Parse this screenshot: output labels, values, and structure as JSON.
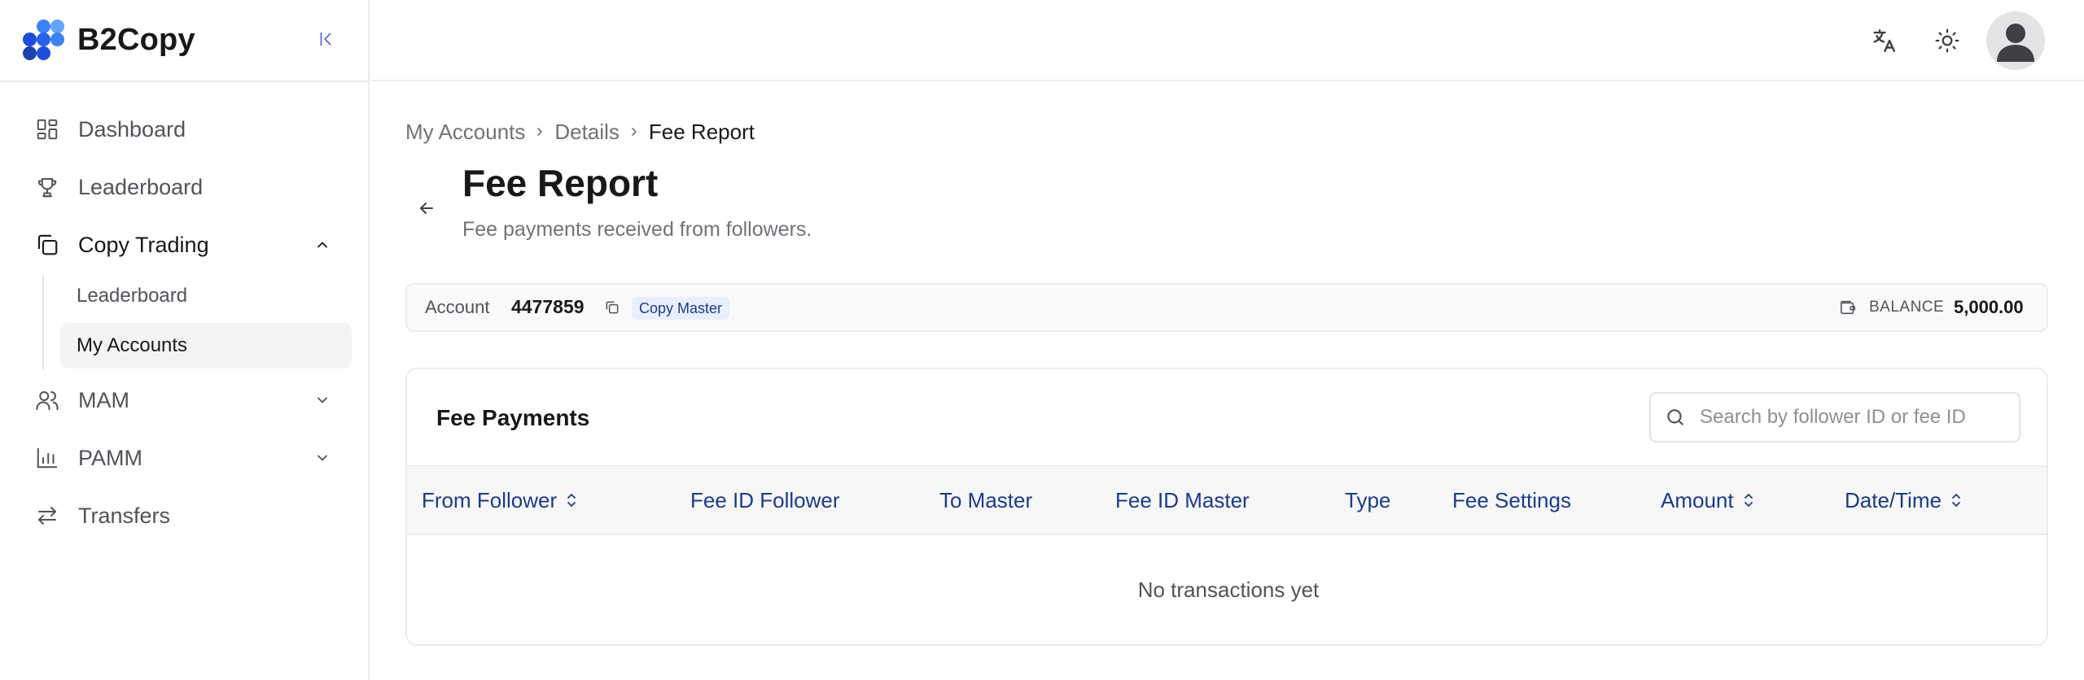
{
  "brand": {
    "name": "B2Copy",
    "colors": {
      "primary": "#2563eb",
      "dark": "#1e3a8a",
      "light": "#60a5fa"
    }
  },
  "sidebar": {
    "collapse_icon": "collapse-left-icon",
    "items": [
      {
        "label": "Dashboard",
        "icon": "dashboard-icon"
      },
      {
        "label": "Leaderboard",
        "icon": "trophy-icon"
      },
      {
        "label": "Copy Trading",
        "icon": "copy-icon",
        "expanded": true,
        "children": [
          {
            "label": "Leaderboard"
          },
          {
            "label": "My Accounts",
            "active": true
          }
        ]
      },
      {
        "label": "MAM",
        "icon": "users-icon",
        "expanded": false
      },
      {
        "label": "PAMM",
        "icon": "bar-chart-icon",
        "expanded": false
      },
      {
        "label": "Transfers",
        "icon": "transfer-icon"
      }
    ]
  },
  "topbar": {
    "icons": [
      "translate-icon",
      "sun-icon",
      "avatar"
    ]
  },
  "breadcrumb": [
    "My Accounts",
    "Details",
    "Fee Report"
  ],
  "page": {
    "title": "Fee Report",
    "subtitle": "Fee payments received from followers."
  },
  "account": {
    "label": "Account",
    "number": "4477859",
    "badge": "Copy Master",
    "balance_label": "BALANCE",
    "balance_value": "5,000.00"
  },
  "table": {
    "title": "Fee Payments",
    "search_placeholder": "Search by follower ID or fee ID",
    "search_value": "",
    "columns": [
      {
        "label": "From Follower",
        "sortable": true
      },
      {
        "label": "Fee ID Follower",
        "sortable": false
      },
      {
        "label": "To Master",
        "sortable": false
      },
      {
        "label": "Fee ID Master",
        "sortable": false
      },
      {
        "label": "Type",
        "sortable": false
      },
      {
        "label": "Fee Settings",
        "sortable": false
      },
      {
        "label": "Amount",
        "sortable": true
      },
      {
        "label": "Date/Time",
        "sortable": true
      }
    ],
    "rows": [],
    "empty_text": "No transactions yet"
  }
}
